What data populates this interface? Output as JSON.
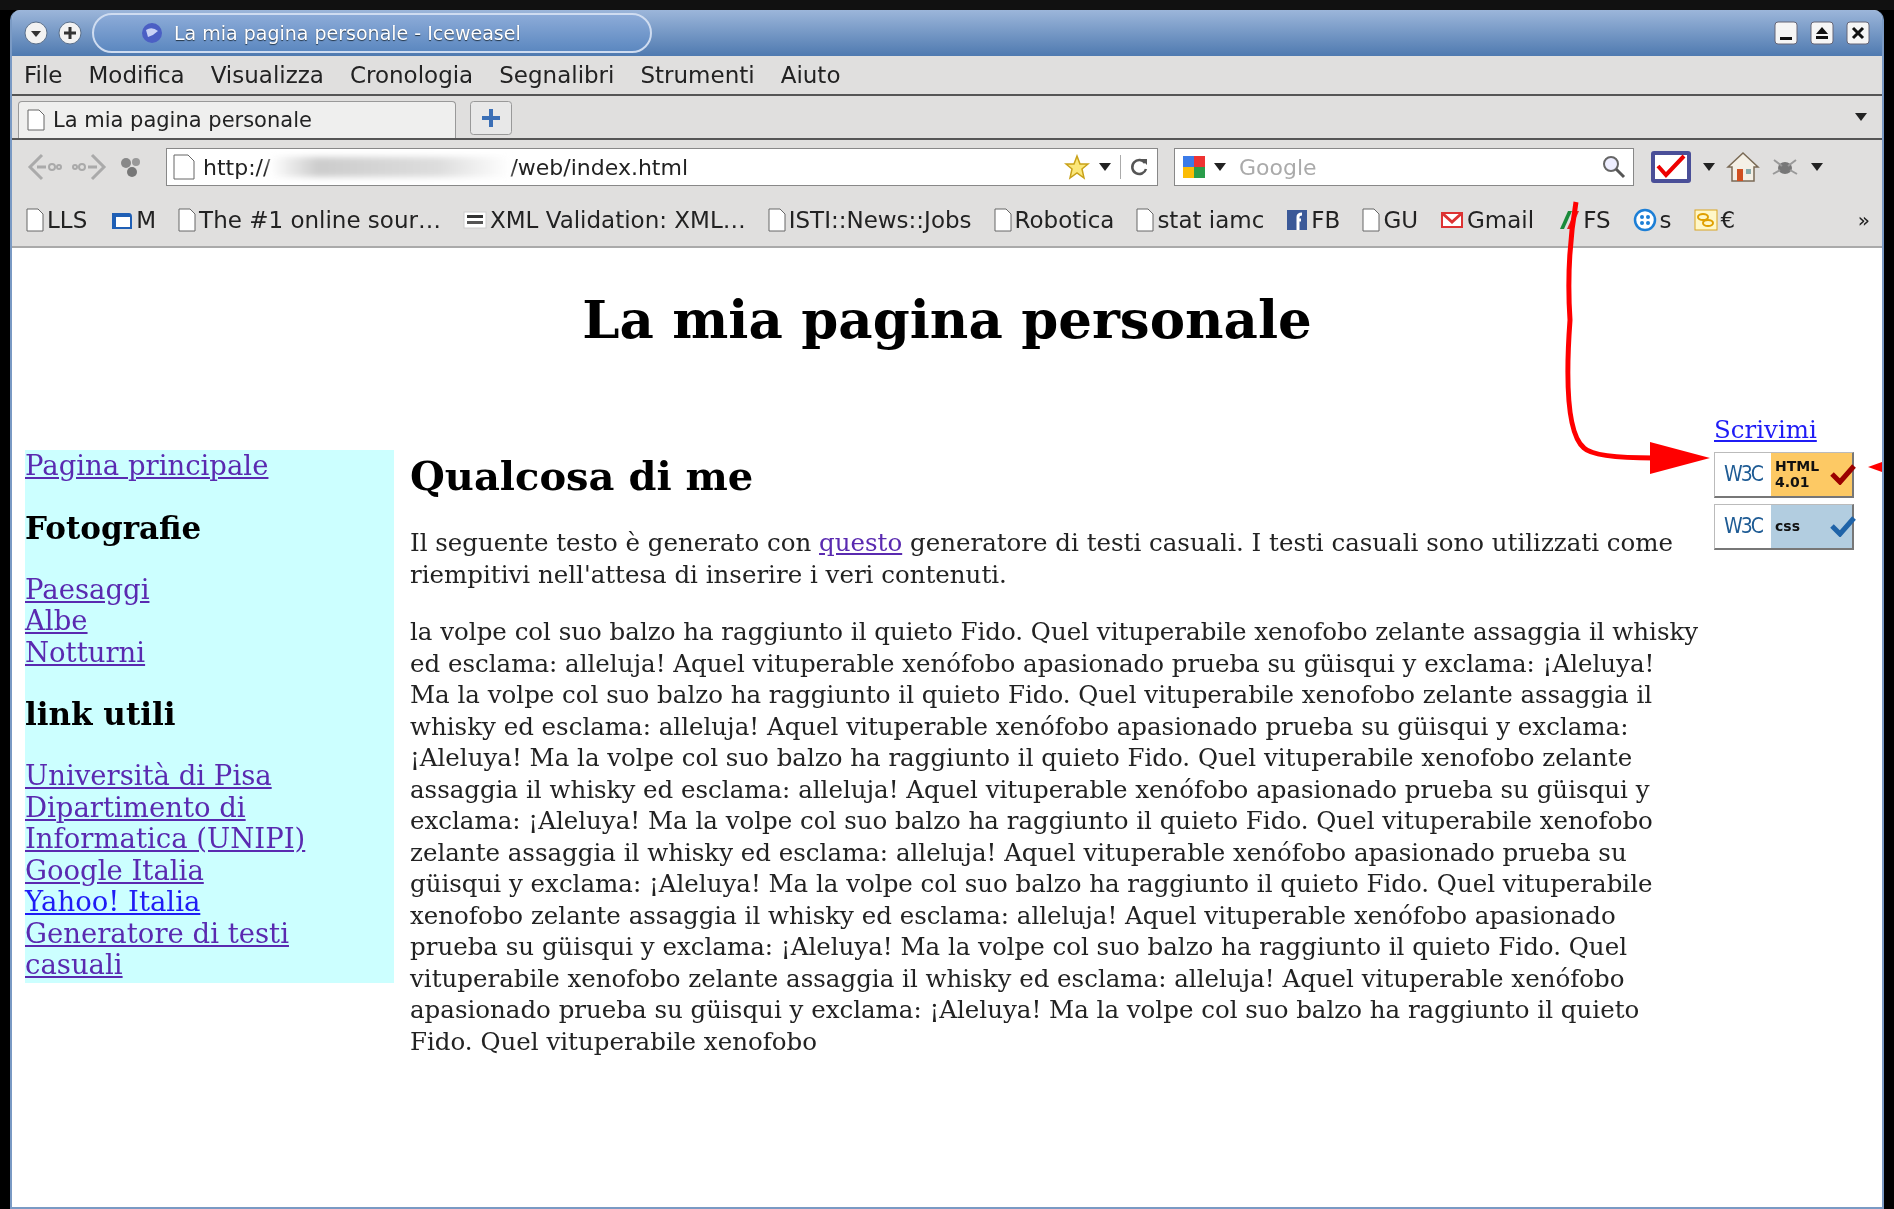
{
  "window": {
    "title": "La mia pagina personale - Iceweasel"
  },
  "menu": [
    "File",
    "Modifica",
    "Visualizza",
    "Cronologia",
    "Segnalibri",
    "Strumenti",
    "Aiuto"
  ],
  "tabs": [
    {
      "label": "La mia pagina personale",
      "selected": true
    }
  ],
  "address_bar": {
    "url_start": "http://",
    "url_end": "/web/index.html"
  },
  "search": {
    "placeholder": "Google"
  },
  "bookmarks": [
    {
      "kind": "page",
      "label": "LLS"
    },
    {
      "kind": "drive",
      "label": "M"
    },
    {
      "kind": "page",
      "label": "The #1 online sour…"
    },
    {
      "kind": "xml",
      "label": "XML Validation: XML…"
    },
    {
      "kind": "page",
      "label": "ISTI::News::Jobs"
    },
    {
      "kind": "page",
      "label": "Robotica"
    },
    {
      "kind": "page",
      "label": "stat iamc"
    },
    {
      "kind": "facebook",
      "label": "FB"
    },
    {
      "kind": "page",
      "label": "GU"
    },
    {
      "kind": "mail",
      "label": "Gmail"
    },
    {
      "kind": "train",
      "label": "FS"
    },
    {
      "kind": "dots",
      "label": "s"
    },
    {
      "kind": "coins",
      "label": "€"
    }
  ],
  "bookmarks_overflow": "»",
  "page": {
    "heading": "La mia pagina personale",
    "sidebar": [
      {
        "kind": "link",
        "text": "Pagina principale",
        "visited": true
      },
      {
        "kind": "heading",
        "text": "Fotografie"
      },
      {
        "kind": "link",
        "text": "Paesaggi",
        "visited": true
      },
      {
        "kind": "link",
        "text": "Albe",
        "visited": true
      },
      {
        "kind": "link",
        "text": "Notturni",
        "visited": true
      },
      {
        "kind": "heading",
        "text": "link utili"
      },
      {
        "kind": "link",
        "text": "Università di Pisa",
        "visited": true
      },
      {
        "kind": "link",
        "text": "Dipartimento di Informatica (UNIPI)",
        "visited": true
      },
      {
        "kind": "link",
        "text": "Google Italia",
        "visited": true
      },
      {
        "kind": "link",
        "text": "Yahoo! Italia",
        "visited": false
      },
      {
        "kind": "link",
        "text": "Generatore di testi casuali",
        "visited": true
      }
    ],
    "main": {
      "heading": "Qualcosa di me",
      "intro": {
        "before": "Il seguente testo è generato con ",
        "link": "questo",
        "link_visited": true,
        "after": " generatore di testi casuali. I testi casuali sono utilizzati come riempitivi nell'attesa di inserire i veri contenuti."
      },
      "body": "la volpe col suo balzo ha raggiunto il quieto Fido. Quel vituperabile xenofobo zelante assaggia il whisky ed esclama: alleluja! Aquel vituperable xenófobo apasionado prueba su güisqui y exclama: ¡Aleluya! Ma la volpe col suo balzo ha raggiunto il quieto Fido. Quel vituperabile xenofobo zelante assaggia il whisky ed esclama: alleluja! Aquel vituperable xenófobo apasionado prueba su güisqui y exclama: ¡Aleluya! Ma la volpe col suo balzo ha raggiunto il quieto Fido. Quel vituperabile xenofobo zelante assaggia il whisky ed esclama: alleluja! Aquel vituperable xenófobo apasionado prueba su güisqui y exclama: ¡Aleluya! Ma la volpe col suo balzo ha raggiunto il quieto Fido. Quel vituperabile xenofobo zelante assaggia il whisky ed esclama: alleluja! Aquel vituperable xenófobo apasionado prueba su güisqui y exclama: ¡Aleluya! Ma la volpe col suo balzo ha raggiunto il quieto Fido. Quel vituperabile xenofobo zelante assaggia il whisky ed esclama: alleluja! Aquel vituperable xenófobo apasionado prueba su güisqui y exclama: ¡Aleluya! Ma la volpe col suo balzo ha raggiunto il quieto Fido. Quel vituperabile xenofobo zelante assaggia il whisky ed esclama: alleluja! Aquel vituperable xenófobo apasionado prueba su güisqui y exclama: ¡Aleluya! Ma la volpe col suo balzo ha raggiunto il quieto Fido. Quel vituperabile xenofobo"
    },
    "aside": {
      "link": {
        "text": "Scrivimi",
        "visited": false
      },
      "badges": [
        {
          "kind": "html",
          "logo": "W3C",
          "label": "HTML",
          "version": "4.01"
        },
        {
          "kind": "css",
          "logo": "W3C",
          "label": "css"
        }
      ]
    }
  }
}
